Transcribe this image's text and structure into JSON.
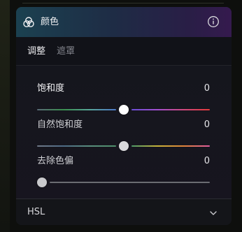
{
  "panel": {
    "title": "颜色",
    "icon": "color-circles-icon",
    "info_icon": "info-icon"
  },
  "tabs": [
    {
      "label": "调整",
      "active": true
    },
    {
      "label": "遮罩",
      "active": false
    }
  ],
  "controls": [
    {
      "label": "饱和度",
      "value": "0",
      "level": 0.5,
      "track_left": [
        "#5a6a77",
        "#3a8f4f",
        "#58a69a",
        "#4d79c9"
      ],
      "track_right": [
        "#6a4ed6",
        "#a34fd0",
        "#d0497e",
        "#e53a3a"
      ],
      "thumb_color": "#ffffff"
    },
    {
      "label": "自然饱和度",
      "value": "0",
      "level": 0.5,
      "track_left": [
        "#707987",
        "#4e6b86",
        "#5a8f7e",
        "#4e8f6a"
      ],
      "track_right": [
        "#4d9a69",
        "#c9b43a",
        "#e0843a",
        "#e05aa0"
      ],
      "thumb_color": "#d9d9dc"
    },
    {
      "label": "去除色偏",
      "value": "0",
      "level": 0.0,
      "track_left": [
        "#6b6c72",
        "#6b6c72"
      ],
      "track_right": [
        "#6b6c72",
        "#6b6c72"
      ],
      "thumb_color": "#c9c9cc"
    }
  ],
  "footer": {
    "label": "HSL",
    "icon": "chevron-down-icon"
  }
}
